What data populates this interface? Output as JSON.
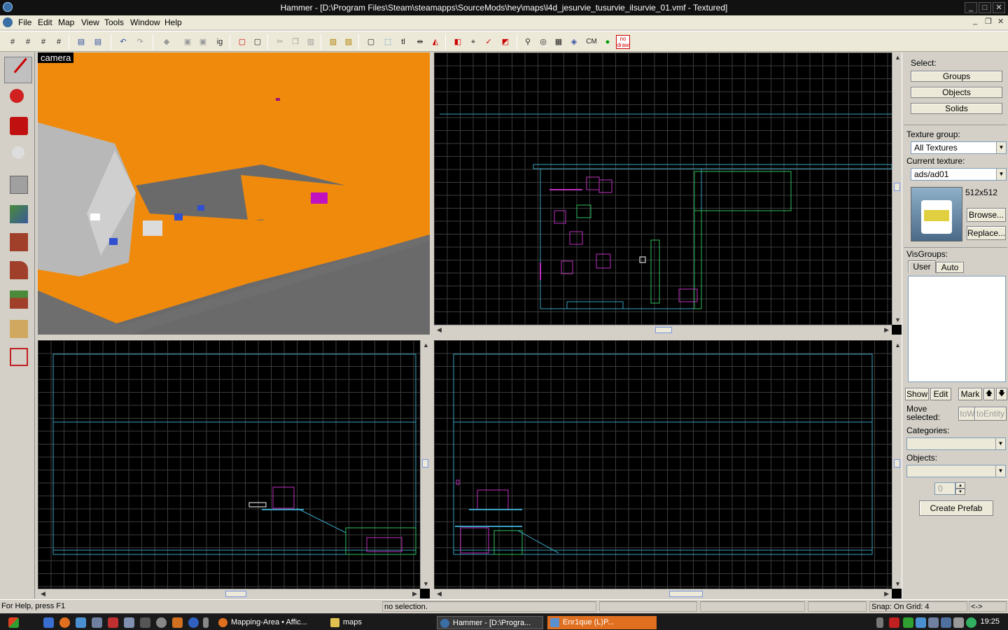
{
  "window": {
    "title": "Hammer - [D:\\Program Files\\Steam\\steamapps\\SourceMods\\hey\\maps\\l4d_jesurvie_tusurvie_ilsurvie_01.vmf - Textured]",
    "minimize": "_",
    "maximize": "□",
    "close": "✕"
  },
  "menu": {
    "items": [
      "File",
      "Edit",
      "Map",
      "View",
      "Tools",
      "Window",
      "Help"
    ],
    "mdi_controls": [
      "_",
      "❐",
      "✕"
    ]
  },
  "toolbar": {
    "ig_label": "ig",
    "tl_label": "tl",
    "cm_label": "CM",
    "nodraw_label": "no draw"
  },
  "left_tools": [
    "selection-tool",
    "magnify-tool",
    "camera-tool",
    "entity-tool",
    "block-tool",
    "texture-application-tool",
    "apply-current-texture-tool",
    "decal-tool",
    "overlay-tool",
    "clipping-tool",
    "vertex-tool"
  ],
  "viewports": {
    "camera_label": "camera"
  },
  "right_panel": {
    "select_label": "Select:",
    "groups_btn": "Groups",
    "objects_btn": "Objects",
    "solids_btn": "Solids",
    "texture_group_label": "Texture group:",
    "texture_group_value": "All Textures",
    "current_texture_label": "Current texture:",
    "current_texture_value": "ads/ad01",
    "texture_size": "512x512",
    "browse_btn": "Browse...",
    "replace_btn": "Replace...",
    "visgroups_label": "VisGroups:",
    "tab_user": "User",
    "tab_auto": "Auto",
    "show_btn": "Show",
    "edit_btn": "Edit",
    "mark_btn": "Mark",
    "up_btn": "🡅",
    "down_btn": "🡇",
    "move_selected_label": "Move selected:",
    "toworld_btn": "toWorld",
    "toentity_btn": "toEntity",
    "categories_label": "Categories:",
    "objects_label": "Objects:",
    "objects_count": "0",
    "create_prefab_btn": "Create Prefab"
  },
  "statusbar": {
    "help": "For Help, press F1",
    "selection": "no selection.",
    "snap": "Snap: On Grid: 4",
    "arrows": "<->"
  },
  "taskbar": {
    "tasks": [
      "Mapping-Area • Affic...",
      "maps",
      "Hammer - [D:\\Progra...",
      "Enr1que          (L)P..."
    ],
    "clock": "19:25"
  },
  "colors": {
    "brush_orange": "#f08a0c",
    "wire_cyan": "#3aa0c0",
    "wire_magenta": "#c030c0",
    "wire_green": "#30c060"
  }
}
